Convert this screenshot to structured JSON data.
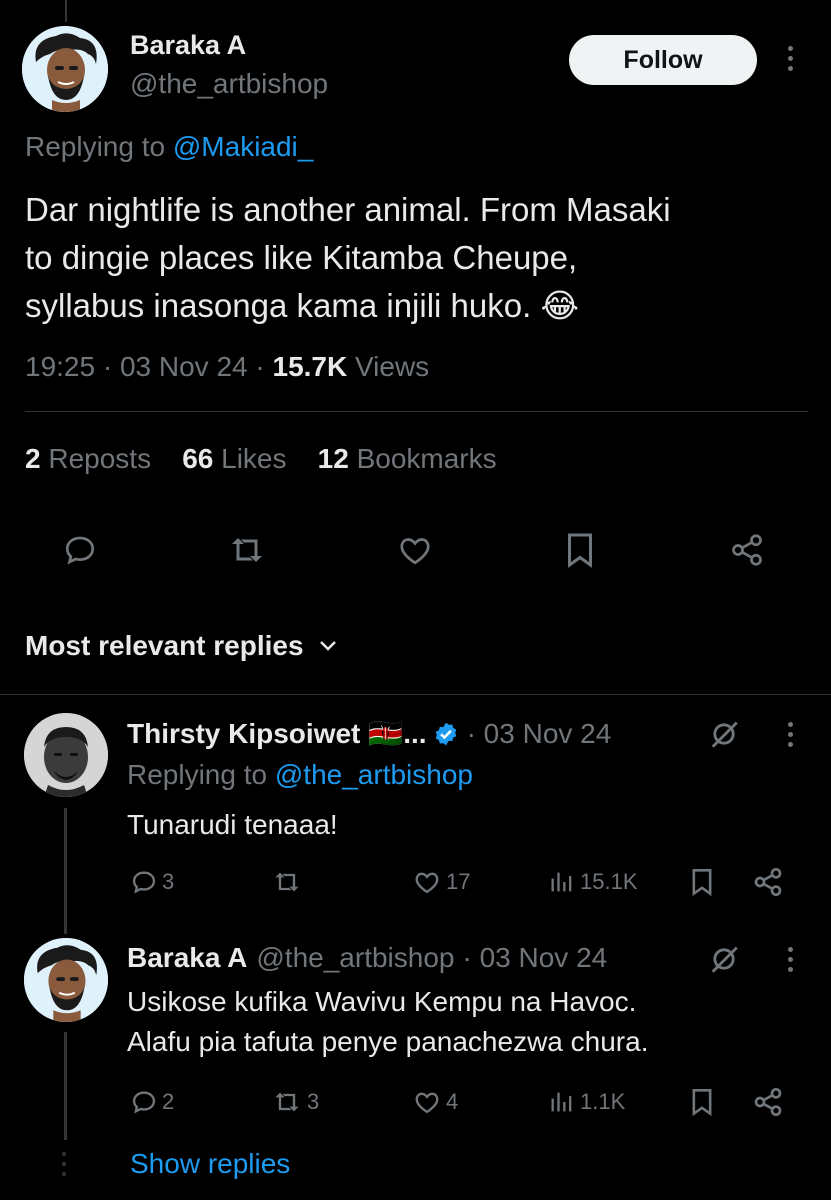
{
  "tweet": {
    "author_name": "Baraka A",
    "author_handle": "@the_artbishop",
    "follow_label": "Follow",
    "replying_prefix": "Replying to ",
    "replying_handle": "@Makiadi_",
    "body_lines": [
      "Dar nightlife is another animal. From Masaki",
      "to dingie places like Kitamba Cheupe,",
      "syllabus inasonga kama injili huko."
    ],
    "emoji": "😂",
    "time": "19:25",
    "date": "03 Nov 24",
    "views_count": "15.7K",
    "views_label": "Views",
    "dot": "·",
    "reposts_count": "2",
    "reposts_label": "Reposts",
    "likes_count": "66",
    "likes_label": "Likes",
    "bookmarks_count": "12",
    "bookmarks_label": "Bookmarks"
  },
  "replies_header": {
    "label": "Most relevant replies"
  },
  "replies": [
    {
      "author_name": "Thirsty Kipsoiwet",
      "name_suffix": "🇰🇪...",
      "date": "· 03 Nov 24",
      "replying_prefix": "Replying to ",
      "replying_handle": "@the_artbishop",
      "text": "Tunarudi tenaaa!",
      "replies": "3",
      "reposts": "",
      "likes": "17",
      "views": "15.1K"
    },
    {
      "author_name": "Baraka A",
      "author_handle": "@the_artbishop",
      "date": "· 03 Nov 24",
      "text_lines": [
        "Usikose kufika Wavivu Kempu na Havoc.",
        "Alafu pia tafuta penye panachezwa chura."
      ],
      "replies": "2",
      "reposts": "3",
      "likes": "4",
      "views": "1.1K"
    }
  ],
  "show_replies_label": "Show replies",
  "colors": {
    "background": "#000000",
    "text": "#e7e9ea",
    "muted": "#71767b",
    "link": "#1d9bf0",
    "verified": "#1d9bf0"
  }
}
